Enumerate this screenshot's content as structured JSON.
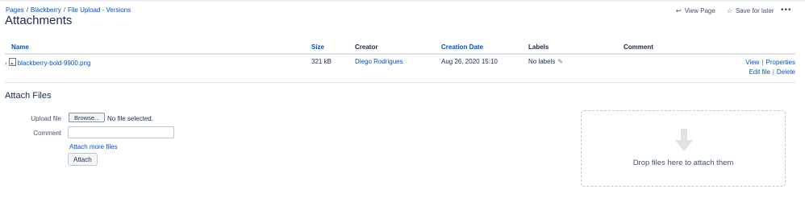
{
  "breadcrumb": [
    "Pages",
    "Blackberry",
    "File Upload - Versions"
  ],
  "page_title": "Attachments",
  "actions": {
    "view_page": "View Page",
    "save_for_later": "Save for later",
    "more": "•••"
  },
  "table": {
    "headers": {
      "name": "Name",
      "size": "Size",
      "creator": "Creator",
      "creation_date": "Creation Date",
      "labels": "Labels",
      "comment": "Comment"
    },
    "rows": [
      {
        "name": "blackberry-bold-9900.png",
        "size": "321 kB",
        "creator": "Diego Rodrigues",
        "creation_date": "Aug 26, 2020 15:10",
        "labels": "No labels",
        "comment": "",
        "ops": {
          "view": "View",
          "properties": "Properties",
          "edit_file": "Edit file",
          "delete": "Delete"
        }
      }
    ]
  },
  "attach": {
    "title": "Attach Files",
    "upload_label": "Upload file",
    "browse": "Browse...",
    "no_file": "No file selected.",
    "comment_label": "Comment",
    "comment_value": "",
    "attach_more": "Attach more files",
    "attach_button": "Attach",
    "drop_text": "Drop files here to attach them"
  },
  "colors": {
    "link": "#0052cc",
    "text": "#172b4d",
    "drop_arrow": "#dfe1e6"
  }
}
